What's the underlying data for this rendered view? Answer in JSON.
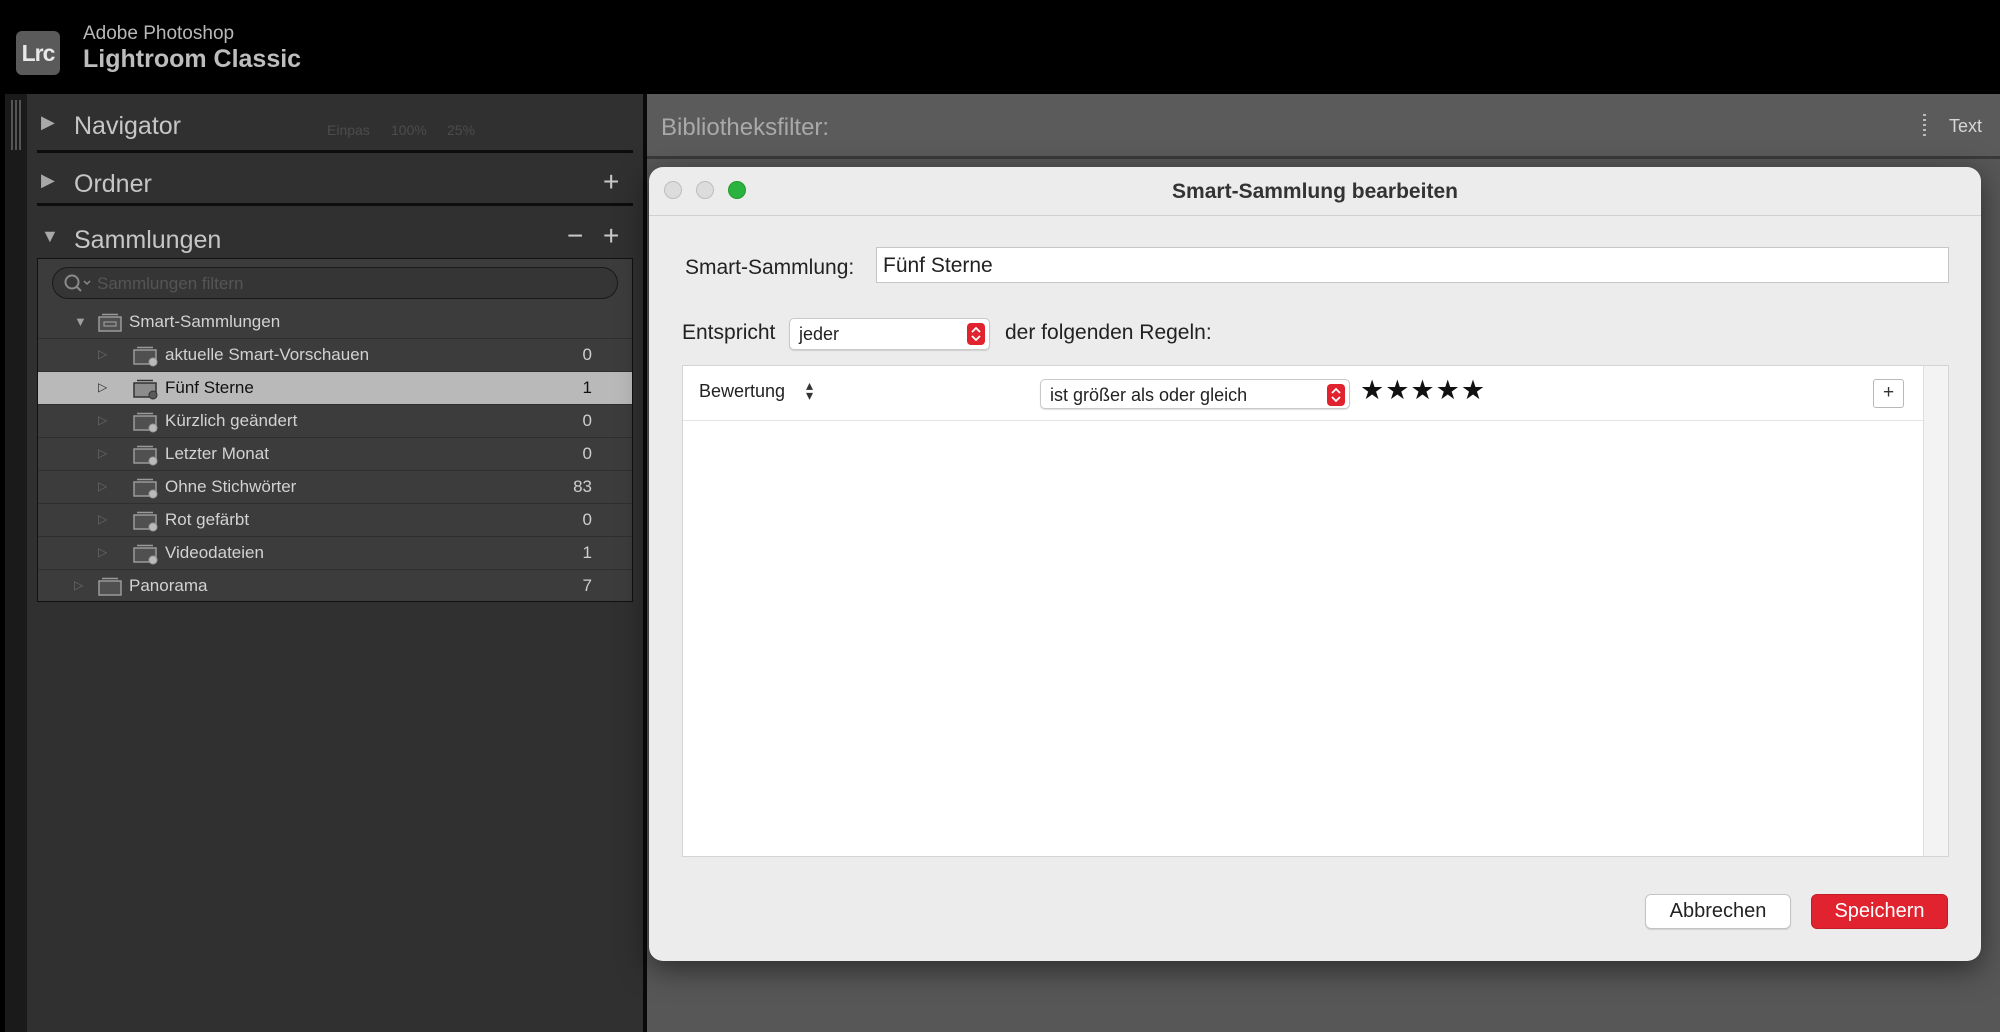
{
  "app": {
    "line1": "Adobe Photoshop",
    "line2": "Lightroom Classic",
    "logo": "Lrc"
  },
  "left_panel": {
    "navigator": {
      "title": "Navigator",
      "zoom_options": [
        "Einpas",
        "100%",
        "25%"
      ]
    },
    "folders": {
      "title": "Ordner"
    },
    "collections": {
      "title": "Sammlungen",
      "search_placeholder": "Sammlungen filtern",
      "items": [
        {
          "label": "Smart-Sammlungen",
          "count": "",
          "level": 0,
          "type": "set",
          "expanded": true,
          "selected": false
        },
        {
          "label": "aktuelle Smart-Vorschauen",
          "count": "0",
          "level": 1,
          "type": "smart",
          "selected": false
        },
        {
          "label": "Fünf Sterne",
          "count": "1",
          "level": 1,
          "type": "smart",
          "selected": true
        },
        {
          "label": "Kürzlich geändert",
          "count": "0",
          "level": 1,
          "type": "smart",
          "selected": false
        },
        {
          "label": "Letzter Monat",
          "count": "0",
          "level": 1,
          "type": "smart",
          "selected": false
        },
        {
          "label": "Ohne Stichwörter",
          "count": "83",
          "level": 1,
          "type": "smart",
          "selected": false
        },
        {
          "label": "Rot gefärbt",
          "count": "0",
          "level": 1,
          "type": "smart",
          "selected": false
        },
        {
          "label": "Videodateien",
          "count": "1",
          "level": 1,
          "type": "smart",
          "selected": false
        },
        {
          "label": "Panorama",
          "count": "7",
          "level": 0,
          "type": "collection",
          "selected": false
        }
      ]
    }
  },
  "filter_bar": {
    "label": "Bibliotheksfilter:",
    "text_tab": "Text"
  },
  "dialog": {
    "title": "Smart-Sammlung bearbeiten",
    "name_label": "Smart-Sammlung:",
    "name_value": "Fünf Sterne",
    "match_label": "Entspricht",
    "match_value": "jeder",
    "match_suffix": "der folgenden Regeln:",
    "rule": {
      "field": "Bewertung",
      "operator": "ist größer als oder gleich",
      "stars": "★★★★★",
      "rating": 5
    },
    "add_rule": "+",
    "cancel": "Abbrechen",
    "save": "Speichern"
  },
  "colors": {
    "accent": "#e0232e",
    "selection": "#b9b9b9",
    "panel": "#303030",
    "zoom_button": "#2ab33f"
  }
}
